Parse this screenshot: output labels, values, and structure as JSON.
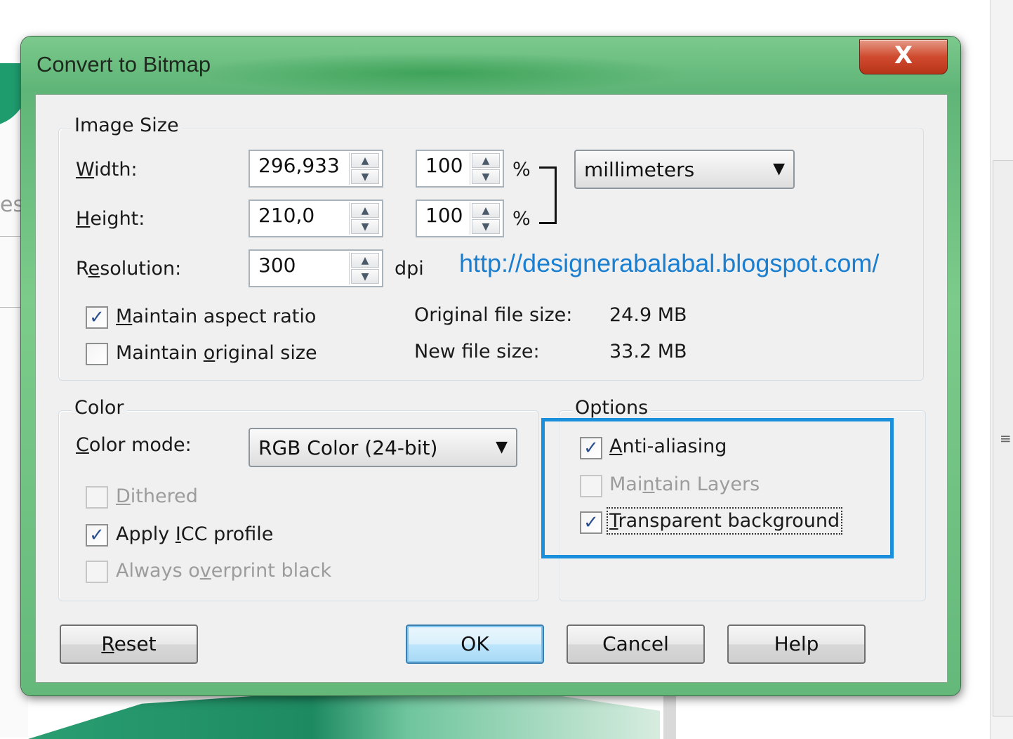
{
  "background": {
    "fragment_text": "es"
  },
  "window": {
    "title": "Convert to Bitmap",
    "close_glyph": "X"
  },
  "image_size": {
    "group_title": "Image Size",
    "width_label": "Width:",
    "width_value": "296,933",
    "width_percent": "100",
    "height_label": "Height:",
    "height_value": "210,0",
    "height_percent": "100",
    "percent_symbol": "%",
    "units": "millimeters",
    "resolution_label": "Resolution:",
    "resolution_value": "300",
    "resolution_unit": "dpi",
    "maintain_aspect_label": "Maintain aspect ratio",
    "maintain_aspect_checked": true,
    "maintain_original_label": "Maintain original size",
    "maintain_original_checked": false,
    "original_size_label": "Original file size:",
    "original_size_value": "24.9 MB",
    "new_size_label": "New file size:",
    "new_size_value": "33.2 MB"
  },
  "watermark": {
    "url": "http://designerabalabal.blogspot.com/"
  },
  "color": {
    "group_title": "Color",
    "mode_label": "Color mode:",
    "mode_value": "RGB Color (24-bit)",
    "dithered_label": "Dithered",
    "apply_icc_label": "Apply ICC profile",
    "always_overprint_label": "Always overprint black"
  },
  "options": {
    "group_title": "Options",
    "anti_aliasing_label": "Anti-aliasing",
    "maintain_layers_label": "Maintain Layers",
    "transparent_bg_label": "Transparent background"
  },
  "buttons": {
    "reset": "Reset",
    "ok": "OK",
    "cancel": "Cancel",
    "help": "Help"
  },
  "colors": {
    "accent_highlight": "#1a8fdc",
    "window_frame": "#6cc07f",
    "close_button": "#cf4a2e"
  }
}
